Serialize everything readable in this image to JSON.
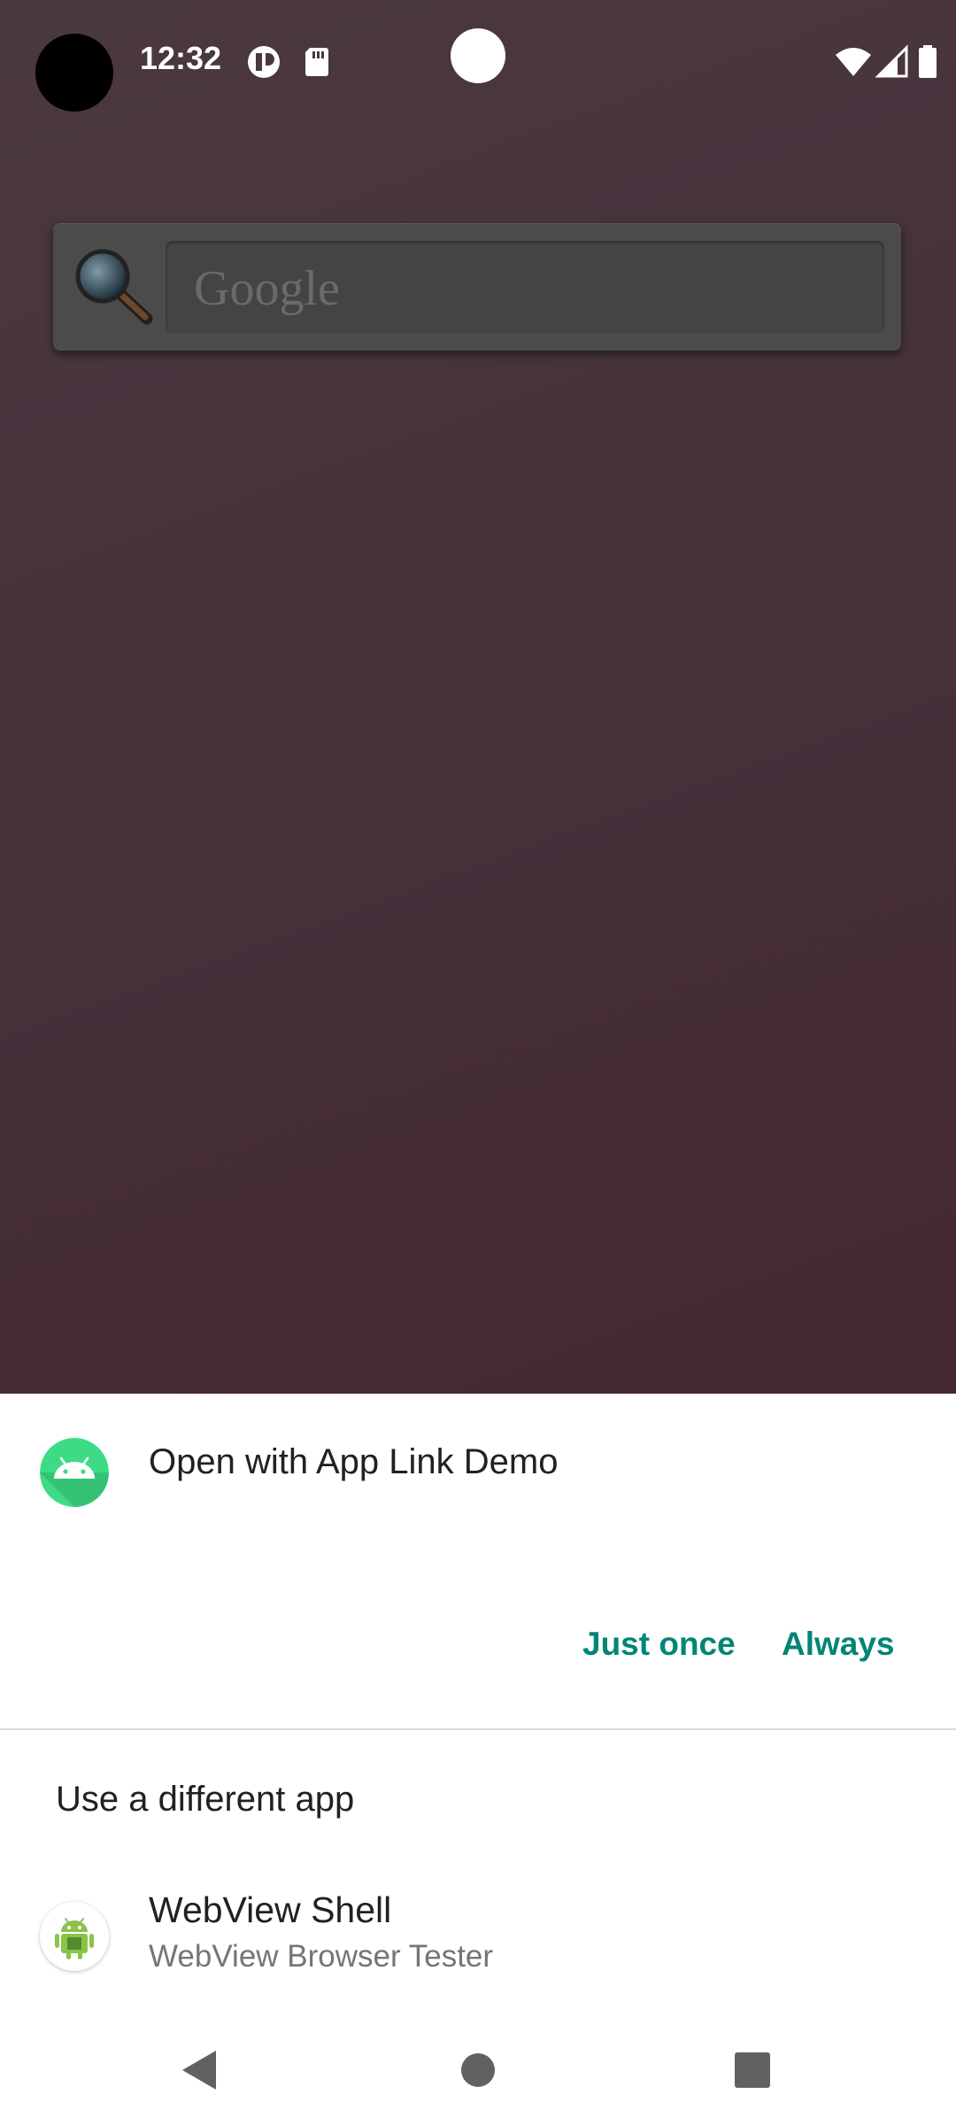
{
  "status_bar": {
    "time": "12:32",
    "icons": [
      "notification-badge-icon",
      "sd-card-icon",
      "wifi-icon",
      "cellular-signal-icon",
      "battery-icon"
    ]
  },
  "search_widget": {
    "placeholder": "Google",
    "icon": "magnifier-icon"
  },
  "dialog": {
    "title": "Open with App Link Demo",
    "icon": "android-app-icon",
    "buttons": {
      "just_once": "Just once",
      "always": "Always"
    },
    "accent_color": "#008577",
    "alt_section": {
      "heading": "Use a different app",
      "apps": [
        {
          "name": "WebView Shell",
          "subtitle": "WebView Browser Tester",
          "icon": "android-robot-icon"
        }
      ]
    }
  },
  "nav_bar": {
    "back": "back-icon",
    "home": "home-icon",
    "recents": "recents-icon"
  }
}
